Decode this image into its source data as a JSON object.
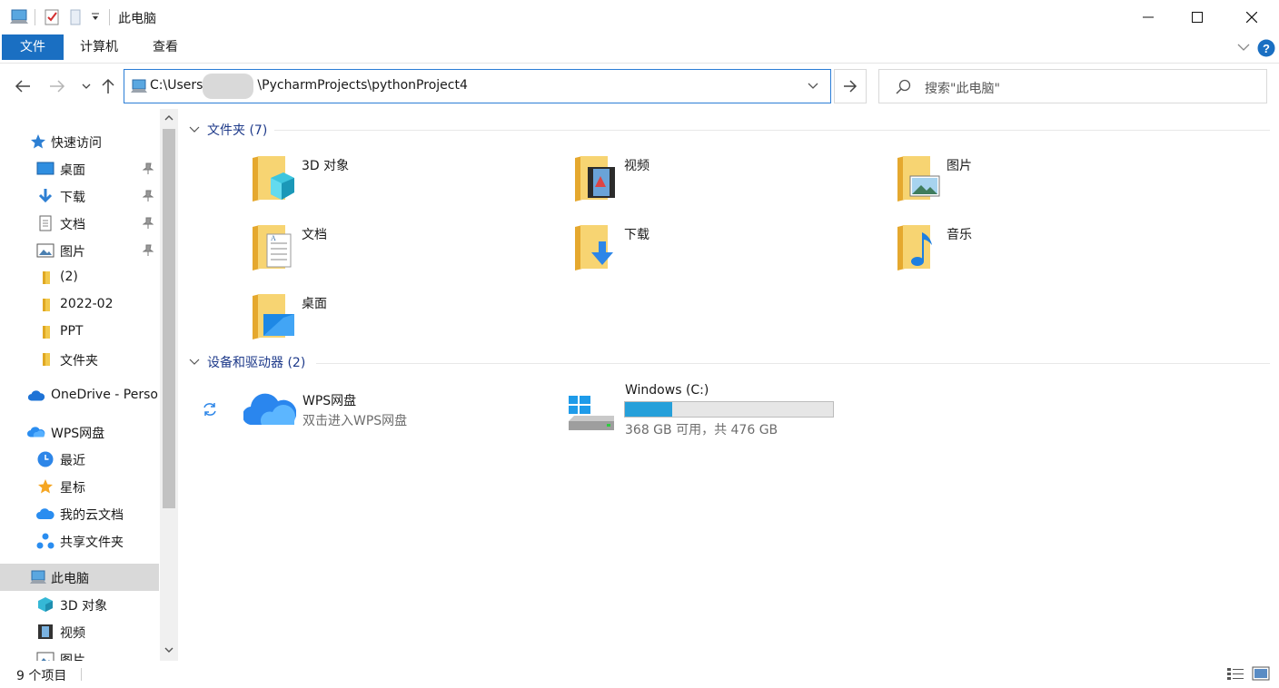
{
  "window": {
    "title": "此电脑",
    "controls": [
      "minimize-icon",
      "maximize-icon",
      "close-icon"
    ]
  },
  "ribbon": {
    "tabs": [
      "文件",
      "计算机",
      "查看"
    ],
    "active_tab": "文件",
    "accent": "#1a6fc2"
  },
  "address": {
    "path_prefix": "C:\\Users",
    "path_suffix": "\\PycharmProjects\\pythonProject4",
    "search_placeholder": "搜索\"此电脑\""
  },
  "sidebar": {
    "quick_access": "快速访问",
    "quick_items": [
      "桌面",
      "下载",
      "文档",
      "图片",
      "(2)",
      "2022-02",
      "PPT",
      "文件夹"
    ],
    "onedrive": "OneDrive - Perso",
    "wps": "WPS网盘",
    "wps_items": [
      "最近",
      "星标",
      "我的云文档",
      "共享文件夹"
    ],
    "thispc": "此电脑",
    "thispc_items": [
      "3D 对象",
      "视频",
      "图片"
    ]
  },
  "main": {
    "folders_header": "文件夹 (7)",
    "folders": [
      "3D 对象",
      "视频",
      "图片",
      "文档",
      "下载",
      "音乐",
      "桌面"
    ],
    "devices_header": "设备和驱动器 (2)",
    "wps_drive": {
      "name": "WPS网盘",
      "desc": "双击进入WPS网盘"
    },
    "c_drive": {
      "name": "Windows (C:)",
      "usage_text": "368 GB 可用，共 476 GB",
      "used_fraction": 0.227,
      "bar_color": "#26a0da"
    }
  },
  "status": {
    "item_count": "9 个项目"
  }
}
